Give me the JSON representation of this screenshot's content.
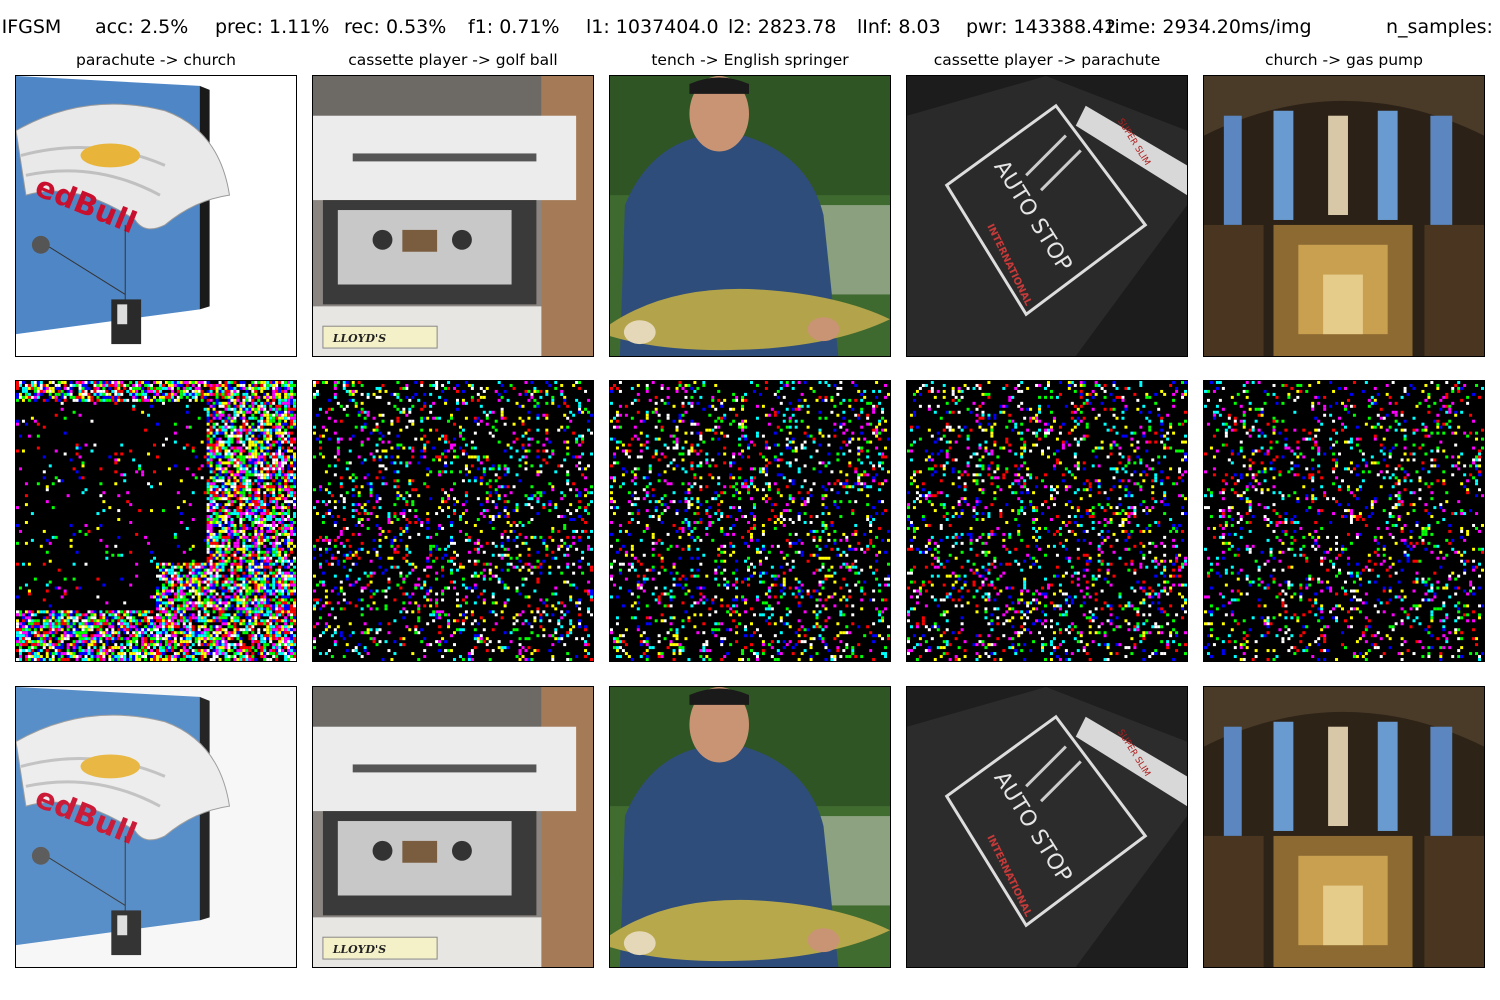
{
  "header": {
    "method": "IIFGSM",
    "acc": "acc: 2.5%",
    "prec": "prec: 1.11%",
    "rec": "rec: 0.53%",
    "f1": "f1: 0.71%",
    "l1": "l1: 1037404.0",
    "l2": "l2: 2823.78",
    "linf": "lInf: 8.03",
    "pwr": "pwr: 143388.42",
    "time": "time: 2934.20ms/img",
    "n_samples": "n_samples:"
  },
  "columns": [
    {
      "title": "parachute -> church"
    },
    {
      "title": "cassette player -> golf ball"
    },
    {
      "title": "tench -> English springer"
    },
    {
      "title": "cassette player -> parachute"
    },
    {
      "title": "church -> gas pump"
    }
  ],
  "image_text": {
    "redbull": "edBull",
    "tape_brand": "LLOYD'S",
    "autostop": "AUTO STOP",
    "international": "INTERNATIONAL",
    "super_slim": "SUPER SLIM"
  }
}
